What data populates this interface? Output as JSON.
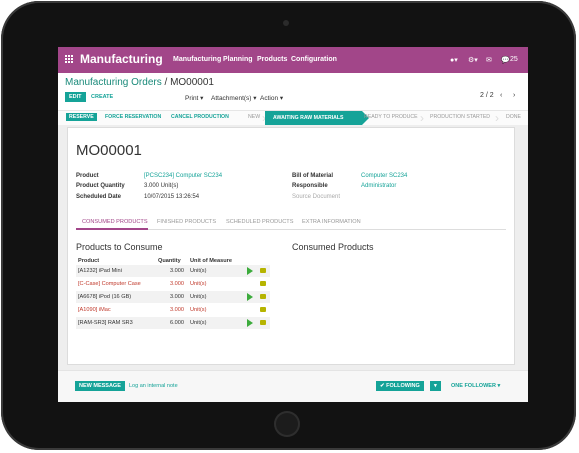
{
  "app": {
    "title": "Manufacturing",
    "menu": [
      "Manufacturing",
      "Planning",
      "Products",
      "Configuration"
    ],
    "notifications": "25"
  },
  "breadcrumb": {
    "parent": "Manufacturing Orders",
    "separator": "/",
    "current": "MO00001"
  },
  "toolbar": {
    "edit": "EDIT",
    "create": "CREATE",
    "print": "Print",
    "attachments": "Attachment(s)",
    "action": "Action",
    "pager": "2 / 2"
  },
  "statusbar": {
    "buttons": [
      "RESERVE",
      "FORCE RESERVATION",
      "CANCEL PRODUCTION"
    ],
    "stages": [
      "NEW",
      "AWAITING RAW MATERIALS",
      "READY TO PRODUCE",
      "PRODUCTION STARTED",
      "DONE"
    ],
    "active_stage": "AWAITING RAW MATERIALS"
  },
  "record": {
    "name": "MO00001",
    "fields_left": [
      {
        "label": "Product",
        "value": "[PCSC234] Computer SC234"
      },
      {
        "label": "Product Quantity",
        "value": "3.000 Unit(s)"
      },
      {
        "label": "Scheduled Date",
        "value": "10/07/2015 13:26:54"
      }
    ],
    "fields_right": [
      {
        "label": "Bill of Material",
        "value": "Computer SC234"
      },
      {
        "label": "Responsible",
        "value": "Administrator"
      },
      {
        "label": "Source Document",
        "value": ""
      }
    ]
  },
  "tabs": [
    "CONSUMED PRODUCTS",
    "FINISHED PRODUCTS",
    "SCHEDULED PRODUCTS",
    "EXTRA INFORMATION"
  ],
  "to_consume": {
    "title": "Products to Consume",
    "headers": [
      "Product",
      "Quantity",
      "Unit of Measure"
    ],
    "rows": [
      {
        "product": "[A1232] iPad Mini",
        "qty": "3.000",
        "uom": "Unit(s)",
        "red": false
      },
      {
        "product": "[C-Case] Computer Case",
        "qty": "3.000",
        "uom": "Unit(s)",
        "red": true
      },
      {
        "product": "[A6678] iPod (16 GB)",
        "qty": "3.000",
        "uom": "Unit(s)",
        "red": false
      },
      {
        "product": "[A1090] iMac",
        "qty": "3.000",
        "uom": "Unit(s)",
        "red": true
      },
      {
        "product": "[RAM-SR3] RAM SR3",
        "qty": "6.000",
        "uom": "Unit(s)",
        "red": false
      }
    ]
  },
  "consumed": {
    "title": "Consumed Products"
  },
  "chatter": {
    "new_message": "NEW MESSAGE",
    "log_note": "Log an internal note",
    "following": "FOLLOWING",
    "followers": "ONE FOLLOWER"
  },
  "colors": {
    "brand": "#a24689",
    "accent": "#15a398",
    "warning": "#c0392b"
  }
}
